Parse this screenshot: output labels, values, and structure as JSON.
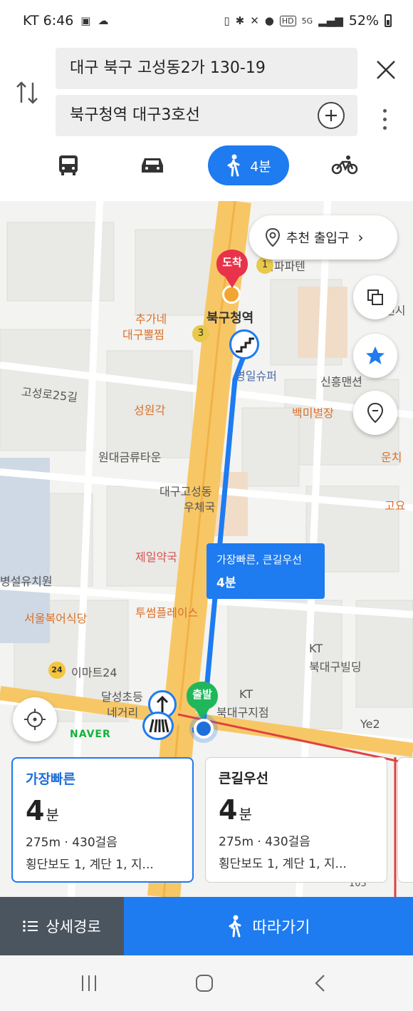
{
  "status_bar": {
    "carrier_time": "KT 6:46",
    "battery": "52%",
    "network": "5G",
    "hd": "HD",
    "icons": [
      "notification-icon",
      "weather-icon",
      "nfc-icon",
      "bluetooth-icon",
      "mute-icon",
      "location-icon",
      "signal-icon",
      "battery-icon"
    ]
  },
  "search": {
    "origin": "대구 북구 고성동2가 130-19",
    "destination": "북구청역 대구3호선",
    "modes": [
      {
        "name": "bus",
        "label": ""
      },
      {
        "name": "car",
        "label": ""
      },
      {
        "name": "walk",
        "label": "4분",
        "selected": true
      },
      {
        "name": "bike",
        "label": ""
      }
    ]
  },
  "map": {
    "entrance_button": "추천 출입구",
    "poi": {
      "p1": "북구청역",
      "p2": "추가네",
      "p3": "대구뽈찜",
      "p4": "영일슈퍼",
      "p5": "신흥맨션",
      "p6": "고성로25길",
      "p7": "성원각",
      "p8": "백미별장",
      "p9": "원대금류타운",
      "p10": "운치",
      "p11": "대구고성동",
      "p12": "우체국",
      "p13": "고요",
      "p14": "제일약국",
      "p15": "병설유치원",
      "p16": "서울복어식당",
      "p17": "투썸플레이스",
      "p18": "KT",
      "p19": "북대구빌딩",
      "p20": "이마트24",
      "p21": "달성초등",
      "p22": "네거리",
      "p23": "KT",
      "p24": "북대구지점",
      "p25": "Ye2",
      "p26": "맨시",
      "p27": "회파파텐",
      "p28": "103"
    },
    "badges": {
      "b1": "1",
      "b3": "3",
      "emart": "24"
    },
    "route_tooltip": {
      "line1": "가장빠른, 큰길우선",
      "line2": "4분"
    },
    "arrive_label": "도착",
    "start_label": "출발",
    "brand": "NAVER",
    "colors": {
      "route": "#1e7bf0",
      "arrive_pin": "#e8334a",
      "start_pin": "#1fb75a",
      "road_major": "#f7c766"
    }
  },
  "route_cards": [
    {
      "name": "가장빠른",
      "time": "4",
      "unit": "분",
      "distance": "275m · 430걸음",
      "detail": "횡단보도 1, 계단 1, 지..."
    },
    {
      "name": "큰길우선",
      "time": "4",
      "unit": "분",
      "distance": "275m · 430걸음",
      "detail": "횡단보도 1, 계단 1, 지..."
    }
  ],
  "actions": {
    "detail": "상세경로",
    "follow": "따라가기"
  }
}
